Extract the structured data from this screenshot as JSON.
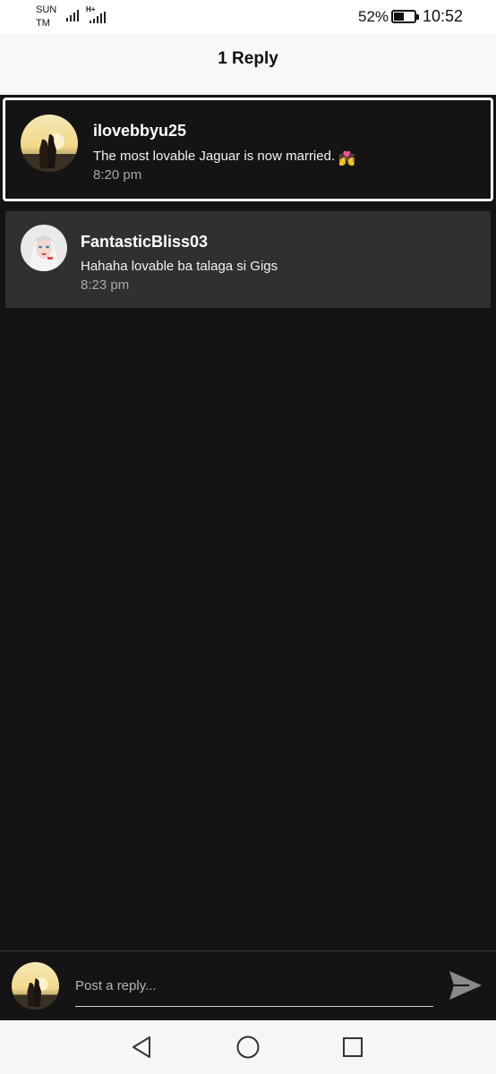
{
  "status_bar": {
    "carrier_line1": "SUN",
    "carrier_line2": "TM",
    "network_tag": "H+",
    "battery_percent": "52%",
    "battery_level": 0.52,
    "time": "10:52",
    "signal_icon": "signal-icon",
    "battery_icon": "battery-icon"
  },
  "header": {
    "title": "1 Reply"
  },
  "original_comment": {
    "username": "ilovebbyu25",
    "text": "The most lovable Jaguar is now married.",
    "emoji": "💏",
    "time": "8:20 pm"
  },
  "replies": [
    {
      "username": "FantasticBliss03",
      "text": "Hahaha lovable ba talaga si Gigs",
      "time": "8:23 pm"
    }
  ],
  "reply_bar": {
    "placeholder": "Post a reply...",
    "value": "",
    "send_icon": "send-icon"
  },
  "nav_bar": {
    "back_icon": "back-triangle-icon",
    "home_icon": "home-circle-icon",
    "recent_icon": "recent-square-icon"
  },
  "colors": {
    "background": "#141414",
    "reply_card": "#303030",
    "header_bg": "#f8f8f8",
    "timestamp": "#a8a8a8"
  }
}
